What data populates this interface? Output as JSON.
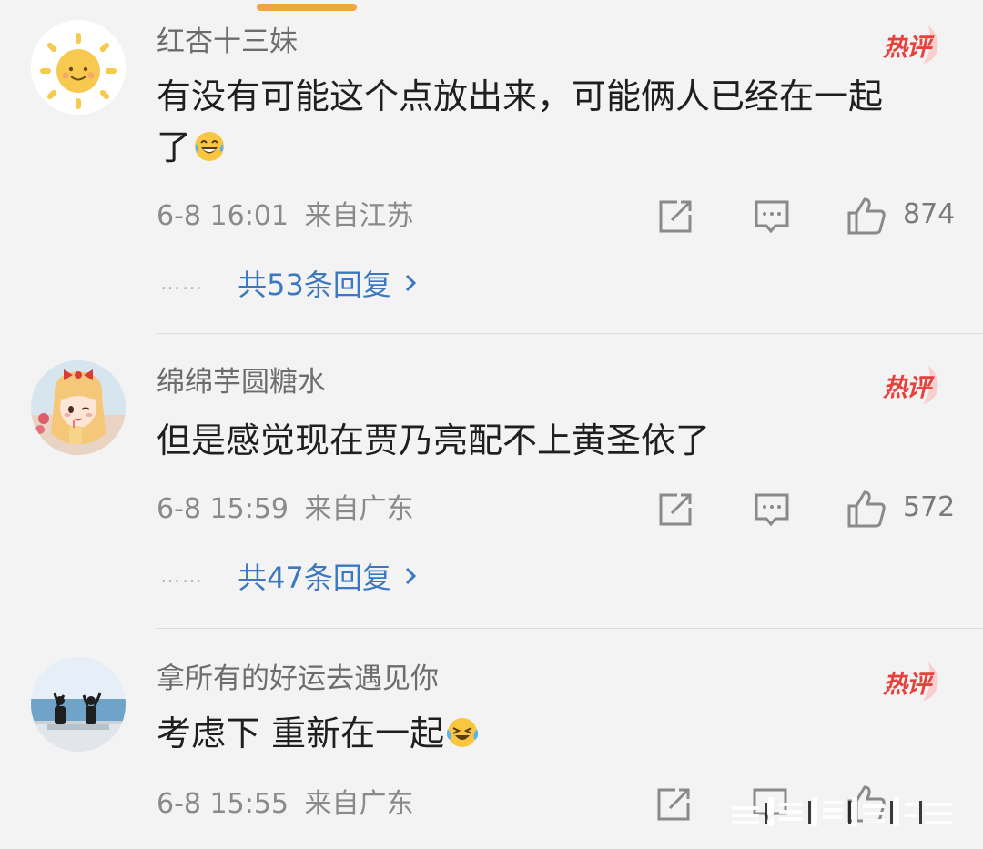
{
  "comments": [
    {
      "username": "红杏十三妹",
      "hot_label": "热评",
      "text_lines": [
        "有没有可能这个点放出来，可能俩人已经在一起",
        "了"
      ],
      "emoji": "laughing-tears-emoji",
      "date": "6-8 16:01",
      "location": "来自江苏",
      "likes": "874",
      "reply_text": "共53条回复",
      "reply_dots": "……",
      "avatar": "sun-avatar"
    },
    {
      "username": "绵绵芋圆糖水",
      "hot_label": "热评",
      "text_lines": [
        "但是感觉现在贾乃亮配不上黄圣依了"
      ],
      "emoji": "",
      "date": "6-8 15:59",
      "location": "来自广东",
      "likes": "572",
      "reply_text": "共47条回复",
      "reply_dots": "……",
      "avatar": "anime-girl-avatar"
    },
    {
      "username": "拿所有的好运去遇见你",
      "hot_label": "热评",
      "text_lines": [
        "考虑下 重新在一起"
      ],
      "emoji": "crying-laughing-emoji",
      "date": "6-8 15:55",
      "location": "来自广东",
      "likes": "",
      "reply_text": "",
      "reply_dots": "",
      "avatar": "seaside-photo-avatar"
    }
  ],
  "icons": {
    "share": "share-icon",
    "comment": "comment-icon",
    "like": "thumbs-up-icon",
    "chevron": "chevron-right-icon"
  },
  "colors": {
    "background": "#f3f3f3",
    "hot_red": "#e8413c",
    "link_blue": "#3b78c0",
    "meta_gray": "#8a8a8a",
    "accent_orange": "#f2a53a"
  }
}
